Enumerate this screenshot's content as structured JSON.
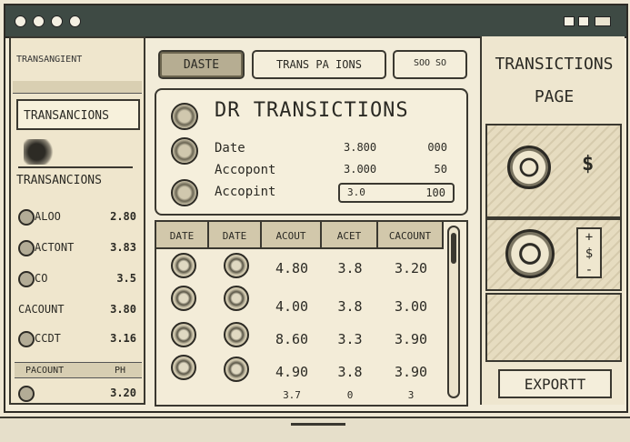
{
  "colors": {
    "ink": "#3a3830",
    "paper": "#f2ecd9",
    "titlebar": "#3e4a44",
    "header_fill": "#d2c8ab"
  },
  "sidebar": {
    "title": "TRANSANGIENT",
    "heading1": "TRANSANCIONS",
    "heading2": "TRANSANCIONS",
    "rows": [
      {
        "label": "ALOO",
        "value": "2.80"
      },
      {
        "label": "ACTONT",
        "value": "3.83"
      },
      {
        "label": "CO",
        "value": "3.5"
      },
      {
        "label": "CACOUNT",
        "value": "3.80"
      },
      {
        "label": "CCDT",
        "value": "3.16"
      }
    ],
    "footer_label": "PACOUNT",
    "footer_value": "PH",
    "last_value": "3.20"
  },
  "toolbar": {
    "tab_date": "DASTE",
    "tab_trans": "TRANS PA IONS",
    "tab_other": "SOO SO"
  },
  "card": {
    "title": "DR TRANSICTIONS",
    "rows": [
      {
        "label": "Date",
        "mid": "3.800",
        "right": "000"
      },
      {
        "label": "Accopont",
        "mid": "3.000",
        "right": "50"
      },
      {
        "label": "Accopint",
        "mid": "3.0",
        "right": "100"
      }
    ]
  },
  "table": {
    "headers": [
      "DATE",
      "DATE",
      "ACOUT",
      "ACET",
      "CACOUNT"
    ],
    "rows": [
      [
        "4.80",
        "3.8",
        "3.20"
      ],
      [
        "4.00",
        "3.8",
        "3.00"
      ],
      [
        "8.60",
        "3.3",
        "3.90"
      ],
      [
        "4.90",
        "3.8",
        "3.90"
      ],
      [
        "3.7",
        "0",
        "3"
      ]
    ]
  },
  "right": {
    "title1": "TRANSICTIONS",
    "title2": "PAGE",
    "dollar1": "$",
    "dollar2": "$",
    "plus": "+",
    "minus": "-",
    "export_label": "EXPORTT"
  }
}
